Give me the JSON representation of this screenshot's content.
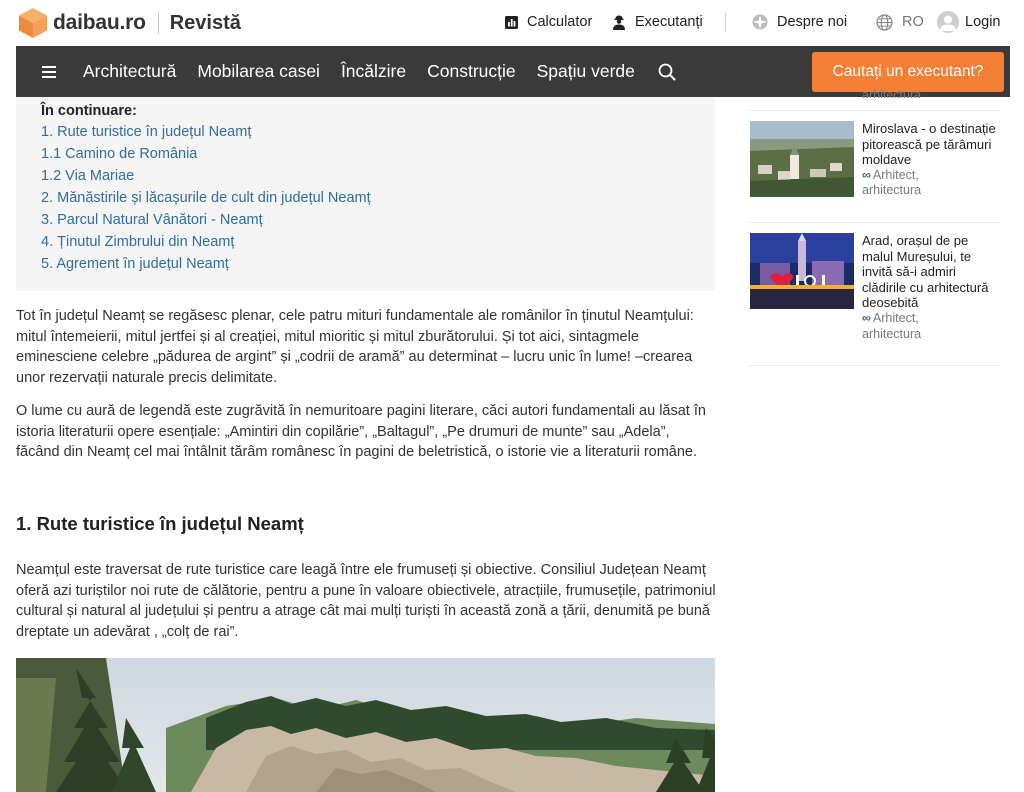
{
  "header": {
    "logo_text": "daibau.ro",
    "section": "Revistă",
    "links": {
      "calculator": "Calculator",
      "executanti": "Executanți",
      "despre": "Despre noi",
      "language": "RO",
      "login": "Login"
    }
  },
  "nav": {
    "items": [
      "Architectură",
      "Mobilarea casei",
      "Încălzire",
      "Construcție",
      "Spațiu verde"
    ],
    "cta": "Cautați un executant?"
  },
  "toc": {
    "title": "În continuare:",
    "items": [
      "1. Rute turistice în județul Neamț",
      "1.1 Camino de România",
      "1.2 Via Mariae",
      "2. Mănăstirile și lăcașurile de cult din județul Neamț",
      "3. Parcul Natural Vânători - Neamț",
      "4.  Ținutul Zimbrului din Neamț",
      "5.  Agrement în județul Neamț"
    ]
  },
  "article": {
    "p1": "Tot în județul Neamț se regăsesc plenar, cele patru mituri fundamentale ale românilor în ținutul Neamțului: mitul întemeierii, mitul jertfei și al creației, mitul mioritic și mitul zburătorului. Și tot aici, sintagmele eminesciene celebre „pădurea de argint” și „codrii de aramă” au determinat – lucru unic în lume! –crearea unor rezervații naturale precis delimitate.",
    "p2": "O lume cu aură de legendă este zugrăvită în nemuritoare pagini literare, căci autori fundamentali au lăsat în istoria literaturii opere esențiale: „Amintiri din copilărie”, „Baltagul”, „Pe drumuri de munte” sau „Adela”, făcând din Neamț cel mai întâlnit tărâm românesc în pagini de beletristică, o istorie vie a literaturii române.",
    "h2": "1. Rute turistice în județul Neamț",
    "p3": "Neamțul este traversat de rute turistice care leagă între ele frumuseți și obiective. Consiliul Județean Neamț oferă azi turiștilor noi rute de călătorie, pentru a pune în valoare obiectivele, atracțiile, frumusețile, patrimoniul cultural și natural al județului și pentru a atrage cât mai mulți turiști în această zonă a țării, denumită pe bună dreptate un adevărat , „colț de rai”."
  },
  "sidebar": {
    "top_fade": "arhitectura",
    "cards": [
      {
        "title": "Miroslava - o destinație pitorească pe tărâmuri moldave",
        "author_icon": "∞",
        "author": "Arhitect,",
        "category": "arhitectura"
      },
      {
        "title": "Arad, orașul de pe malul Mureșului, te invită să-i admiri clădirile cu arhitectură deosebită",
        "author_icon": "∞",
        "author": "Arhitect,",
        "category": "arhitectura"
      }
    ]
  },
  "colors": {
    "accent": "#f57f35",
    "nav_bg": "#3a3a3a",
    "link": "#2f6e9e"
  }
}
